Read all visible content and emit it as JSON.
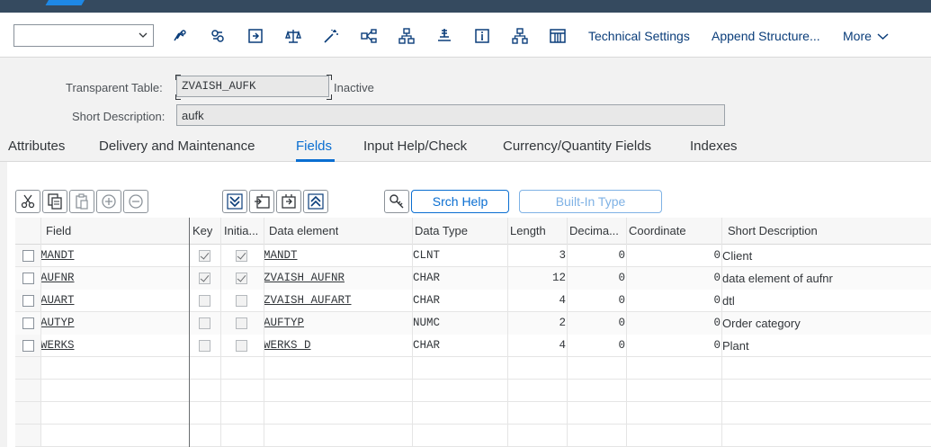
{
  "toolbar": {
    "select_value": "",
    "technical_settings": "Technical Settings",
    "append_structure": "Append Structure...",
    "more": "More",
    "icons": [
      "glasses-icon",
      "where-used-icon",
      "transport-icon",
      "scales-icon",
      "magic-wand-icon",
      "hierarchy-icon",
      "sitemap-icon",
      "stack-icon",
      "info-icon",
      "network-icon",
      "columns-icon"
    ]
  },
  "header": {
    "table_label": "Transparent Table:",
    "table_name": "ZVAISH_AUFK",
    "status": "Inactive",
    "desc_label": "Short Description:",
    "description": "aufk"
  },
  "tabs": [
    "Attributes",
    "Delivery and Maintenance",
    "Fields",
    "Input Help/Check",
    "Currency/Quantity Fields",
    "Indexes"
  ],
  "active_tab": "Fields",
  "buttons": {
    "srch_help": "Srch Help",
    "builtin_type": "Built-In Type"
  },
  "table": {
    "columns": [
      "Field",
      "Key",
      "Initia...",
      "Data element",
      "Data Type",
      "Length",
      "Decima...",
      "Coordinate",
      "Short Description"
    ],
    "rows": [
      {
        "field": "MANDT",
        "key": true,
        "initial": true,
        "data_element": "MANDT",
        "data_type": "CLNT",
        "length": "3",
        "decimals": "0",
        "coordinate": "0",
        "description": "Client"
      },
      {
        "field": "AUFNR",
        "key": true,
        "initial": true,
        "data_element": "ZVAISH_AUFNR",
        "data_type": "CHAR",
        "length": "12",
        "decimals": "0",
        "coordinate": "0",
        "description": "data element of aufnr"
      },
      {
        "field": "AUART",
        "key": false,
        "initial": false,
        "data_element": "ZVAISH_AUFART",
        "data_type": "CHAR",
        "length": "4",
        "decimals": "0",
        "coordinate": "0",
        "description": "dtl"
      },
      {
        "field": "AUTYP",
        "key": false,
        "initial": false,
        "data_element": "AUFTYP",
        "data_type": "NUMC",
        "length": "2",
        "decimals": "0",
        "coordinate": "0",
        "description": "Order category"
      },
      {
        "field": "WERKS",
        "key": false,
        "initial": false,
        "data_element": "WERKS_D",
        "data_type": "CHAR",
        "length": "4",
        "decimals": "0",
        "coordinate": "0",
        "description": "Plant"
      }
    ]
  },
  "colors": {
    "accent": "#0a6ed1",
    "shell": "#354a5f",
    "link": "#0a3d7a"
  }
}
